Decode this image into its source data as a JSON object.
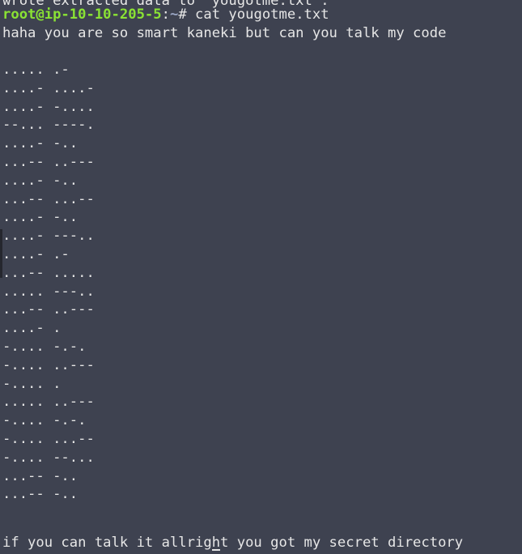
{
  "terminal": {
    "clipped_top_line": "wrote extracted data to \"yougotme.txt\".",
    "prompt": {
      "user_host": "root@ip-10-10-205-5",
      "separator": ":",
      "path": "~",
      "symbol": "# ",
      "command": "cat yougotme.txt"
    },
    "message_line": "haha you are so smart kaneki but can you talk my code",
    "morse_lines": [
      "..... .-",
      "....- ....-",
      "....- -....",
      "--... ----.",
      "....- -..",
      "...-- ..---",
      "....- -..",
      "...-- ...--",
      "....- -..",
      "....- ---..",
      "....- .-",
      "...-- .....",
      "..... ---..",
      "...-- ..---",
      "....- .",
      "-.... -.-.",
      "-.... ..---",
      "-.... .",
      "..... ..---",
      "-.... -.-.",
      "-.... ...--",
      "-.... --...",
      "...-- -..",
      "...-- -.."
    ],
    "final_line": "if you can talk it allright you got my secret directory"
  },
  "colors": {
    "background": "#3e4250",
    "text": "#e6e6e6",
    "prompt_user": "#8ae234",
    "prompt_path": "#9aa6c4"
  }
}
